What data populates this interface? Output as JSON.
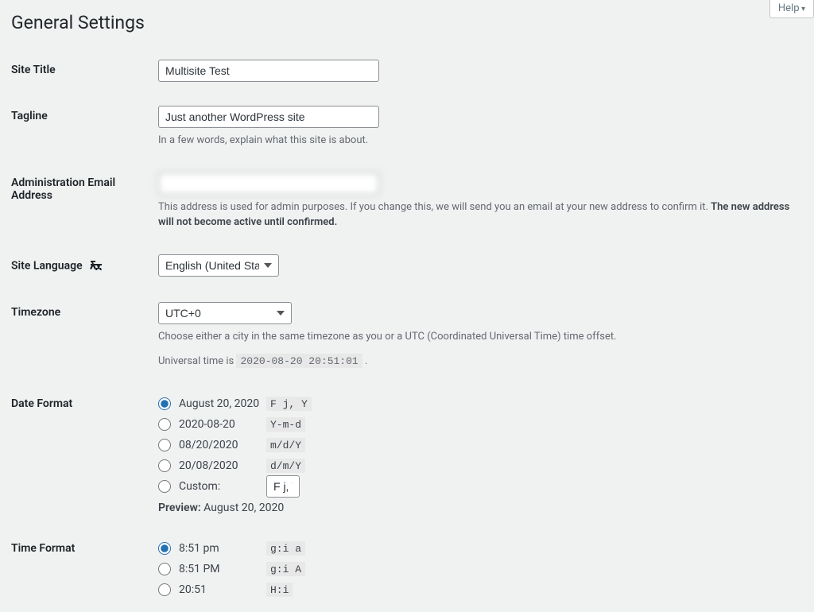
{
  "help_label": "Help",
  "page_title": "General Settings",
  "fields": {
    "site_title": {
      "label": "Site Title",
      "value": "Multisite Test"
    },
    "tagline": {
      "label": "Tagline",
      "value": "Just another WordPress site",
      "desc": "In a few words, explain what this site is about."
    },
    "admin_email": {
      "label": "Administration Email Address",
      "value": "",
      "desc_part1": "This address is used for admin purposes. If you change this, we will send you an email at your new address to confirm it. ",
      "desc_bold": "The new address will not become active until confirmed."
    },
    "site_language": {
      "label": "Site Language ",
      "value": "English (United States)"
    },
    "timezone": {
      "label": "Timezone",
      "value": "UTC+0",
      "desc": "Choose either a city in the same timezone as you or a UTC (Coordinated Universal Time) time offset.",
      "universal_prefix": "Universal time is ",
      "universal_time": "2020-08-20 20:51:01",
      "universal_suffix": " ."
    },
    "date_format": {
      "label": "Date Format",
      "options": [
        {
          "text": "August 20, 2020",
          "code": "F j, Y",
          "checked": true
        },
        {
          "text": "2020-08-20",
          "code": "Y-m-d",
          "checked": false
        },
        {
          "text": "08/20/2020",
          "code": "m/d/Y",
          "checked": false
        },
        {
          "text": "20/08/2020",
          "code": "d/m/Y",
          "checked": false
        }
      ],
      "custom_label": "Custom:",
      "custom_value": "F j, Y",
      "preview_label": "Preview:",
      "preview_value": " August 20, 2020"
    },
    "time_format": {
      "label": "Time Format",
      "options": [
        {
          "text": "8:51 pm",
          "code": "g:i a",
          "checked": true
        },
        {
          "text": "8:51 PM",
          "code": "g:i A",
          "checked": false
        },
        {
          "text": "20:51",
          "code": "H:i",
          "checked": false
        }
      ]
    }
  }
}
